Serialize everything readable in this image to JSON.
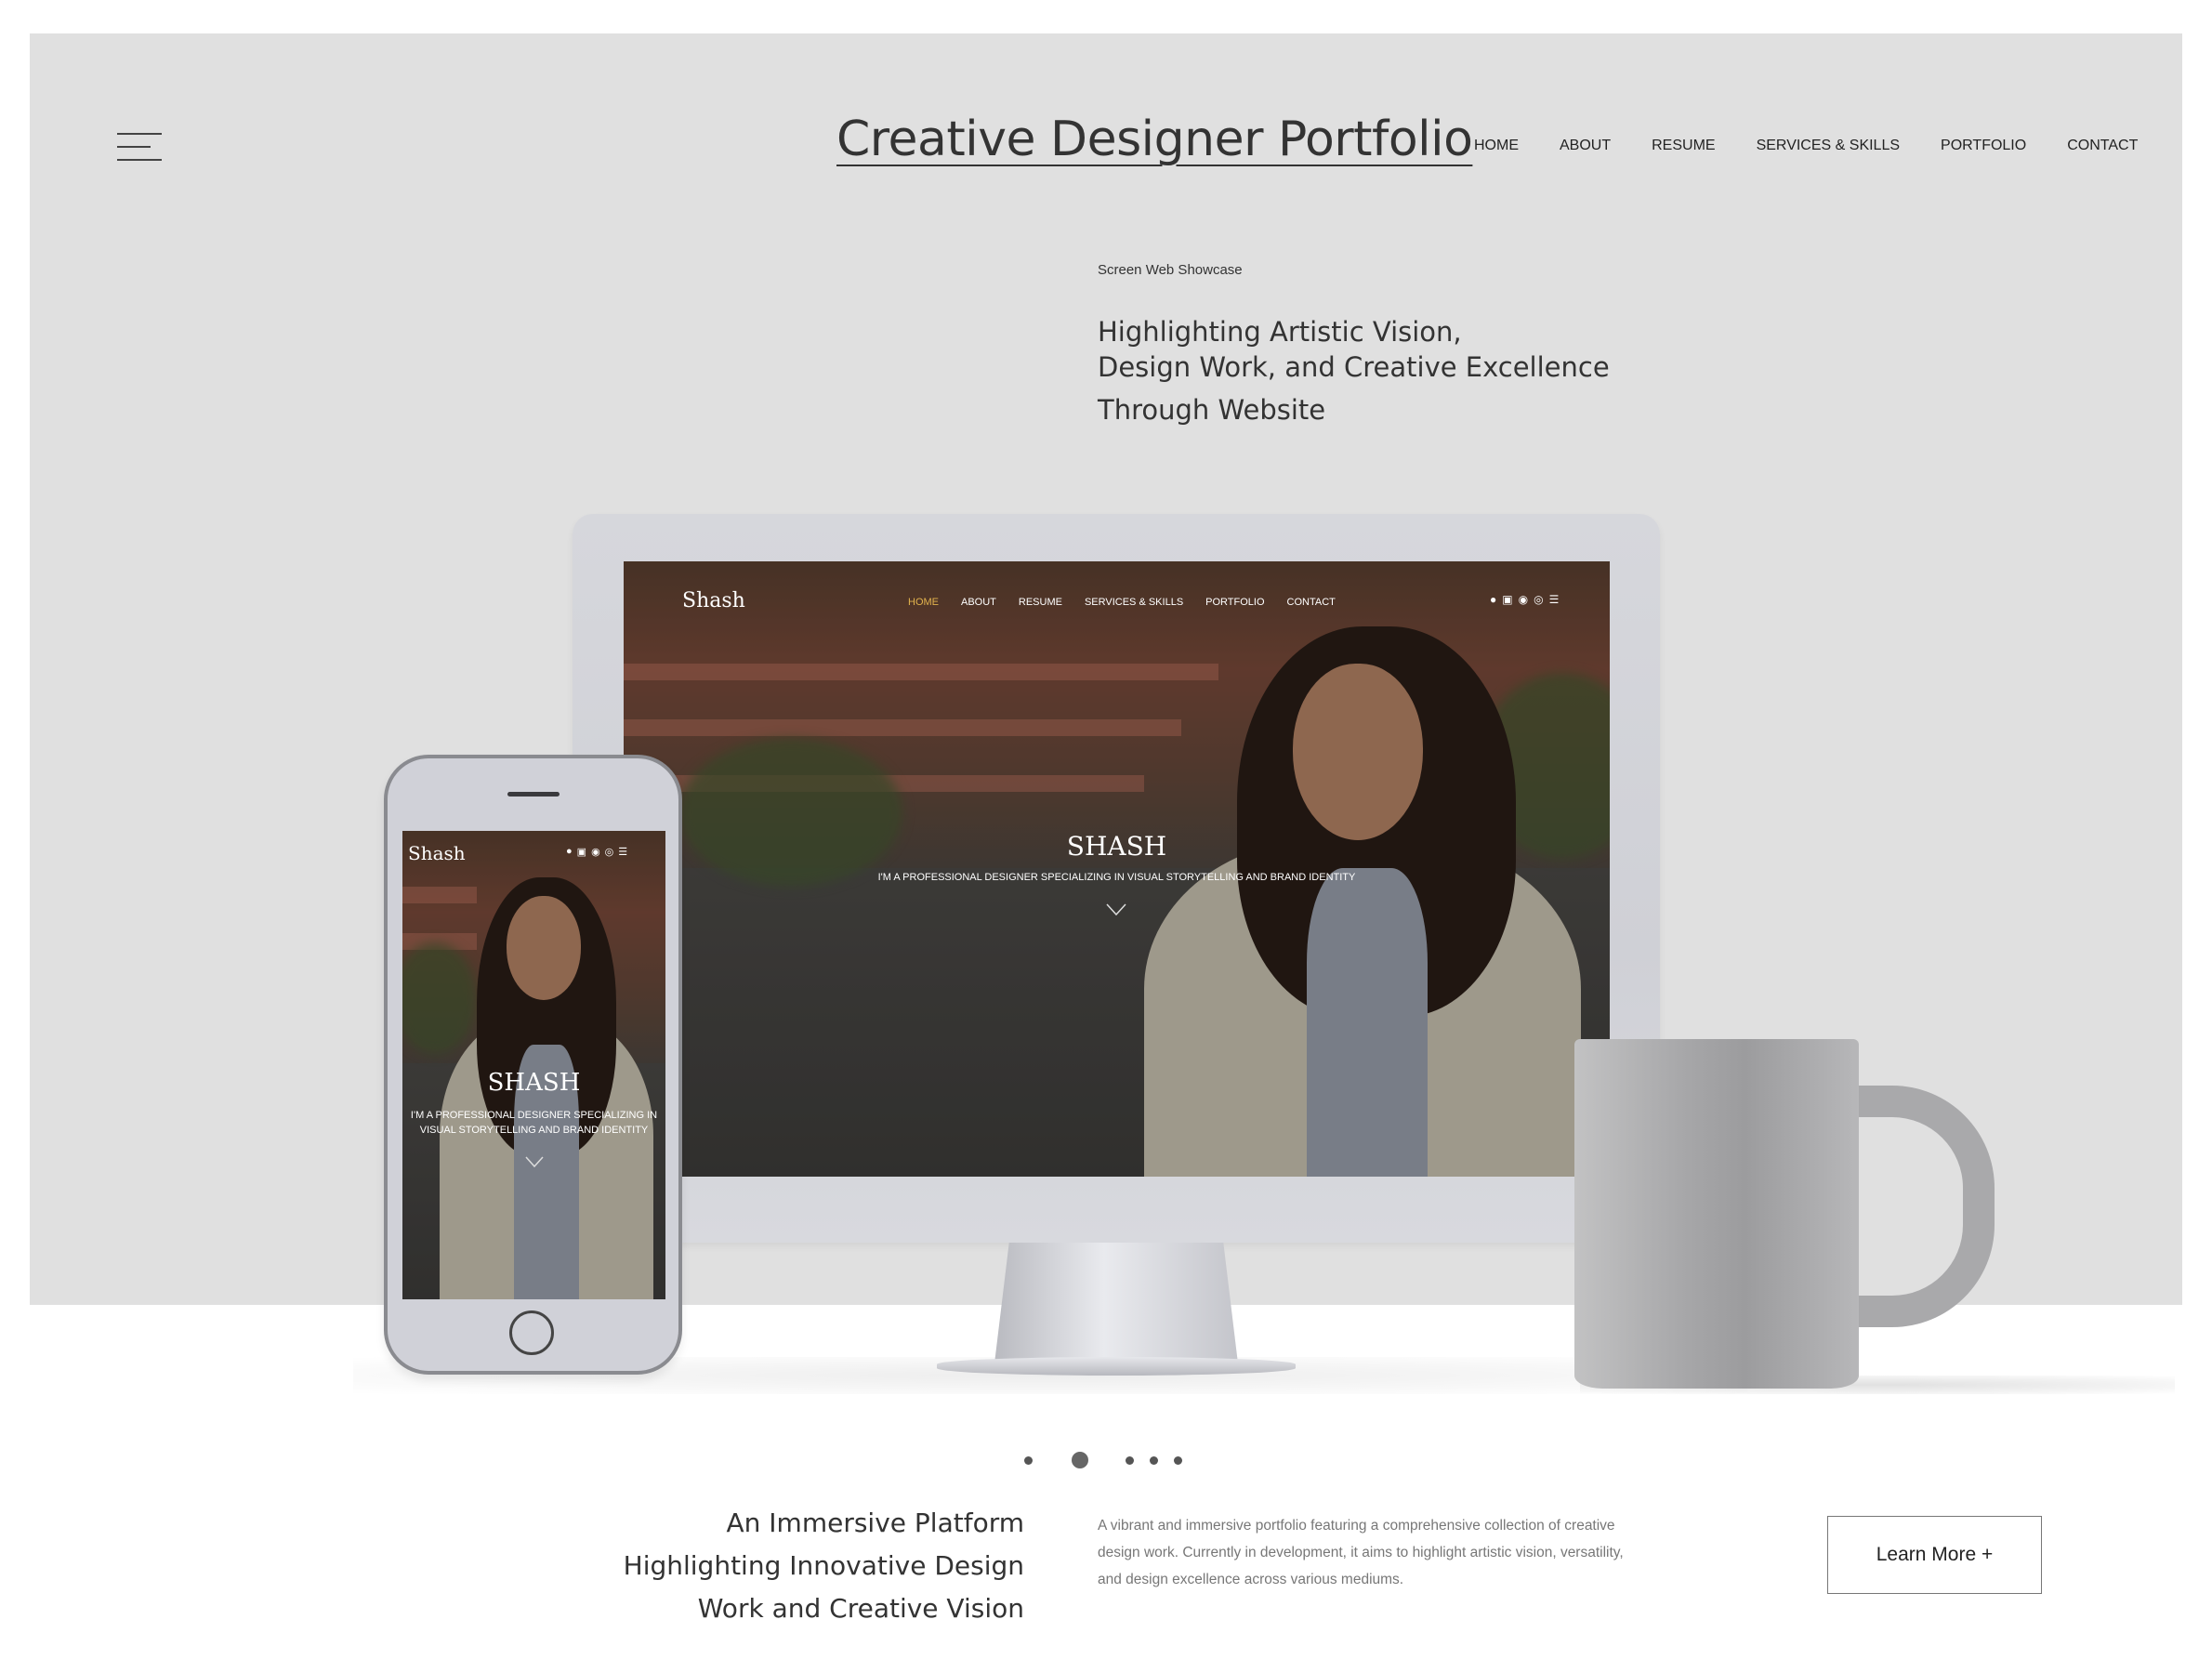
{
  "header": {
    "site_title": "Creative Designer Portfolio",
    "menu_icon": "hamburger-menu-icon",
    "nav": [
      "HOME",
      "ABOUT",
      "RESUME",
      "SERVICES & SKILLS",
      "PORTFOLIO",
      "CONTACT"
    ]
  },
  "hero": {
    "eyebrow": "Screen Web Showcase",
    "headline": [
      "Highlighting Artistic Vision,",
      "Design Work, and Creative Excellence",
      "Through Website"
    ]
  },
  "desktop_mockup": {
    "logo": "Shash",
    "nav": [
      "HOME",
      "ABOUT",
      "RESUME",
      "SERVICES & SKILLS",
      "PORTFOLIO",
      "CONTACT"
    ],
    "active_nav": "HOME",
    "active_color": "#e2b24d",
    "icons": [
      "user-icon",
      "linkedin-icon",
      "facebook-icon",
      "instagram-icon",
      "menu-icon"
    ],
    "name": "SHASH",
    "tagline": "I'M A PROFESSIONAL DESIGNER SPECIALIZING IN VISUAL STORYTELLING AND BRAND IDENTITY",
    "scroll_icon": "chevron-down-icon"
  },
  "mobile_mockup": {
    "logo": "Shash",
    "icons": [
      "user-icon",
      "linkedin-icon",
      "facebook-icon",
      "instagram-icon",
      "menu-icon"
    ],
    "name": "SHASH",
    "tagline": "I'M A PROFESSIONAL DESIGNER SPECIALIZING IN VISUAL STORYTELLING AND BRAND IDENTITY",
    "scroll_icon": "chevron-down-icon"
  },
  "slider": {
    "dot_count": 5,
    "active_index": 1
  },
  "feature": {
    "title": [
      "An Immersive Platform",
      "Highlighting Innovative Design",
      "Work and Creative Vision"
    ],
    "description": "A vibrant and immersive portfolio featuring a comprehensive collection of creative design work. Currently in development, it aims to highlight artistic vision, versatility, and design excellence across various mediums.",
    "button_label": "Learn More +"
  },
  "colors": {
    "hero_background": "#e0e0e0",
    "text": "#333333",
    "muted_text": "#777777"
  }
}
